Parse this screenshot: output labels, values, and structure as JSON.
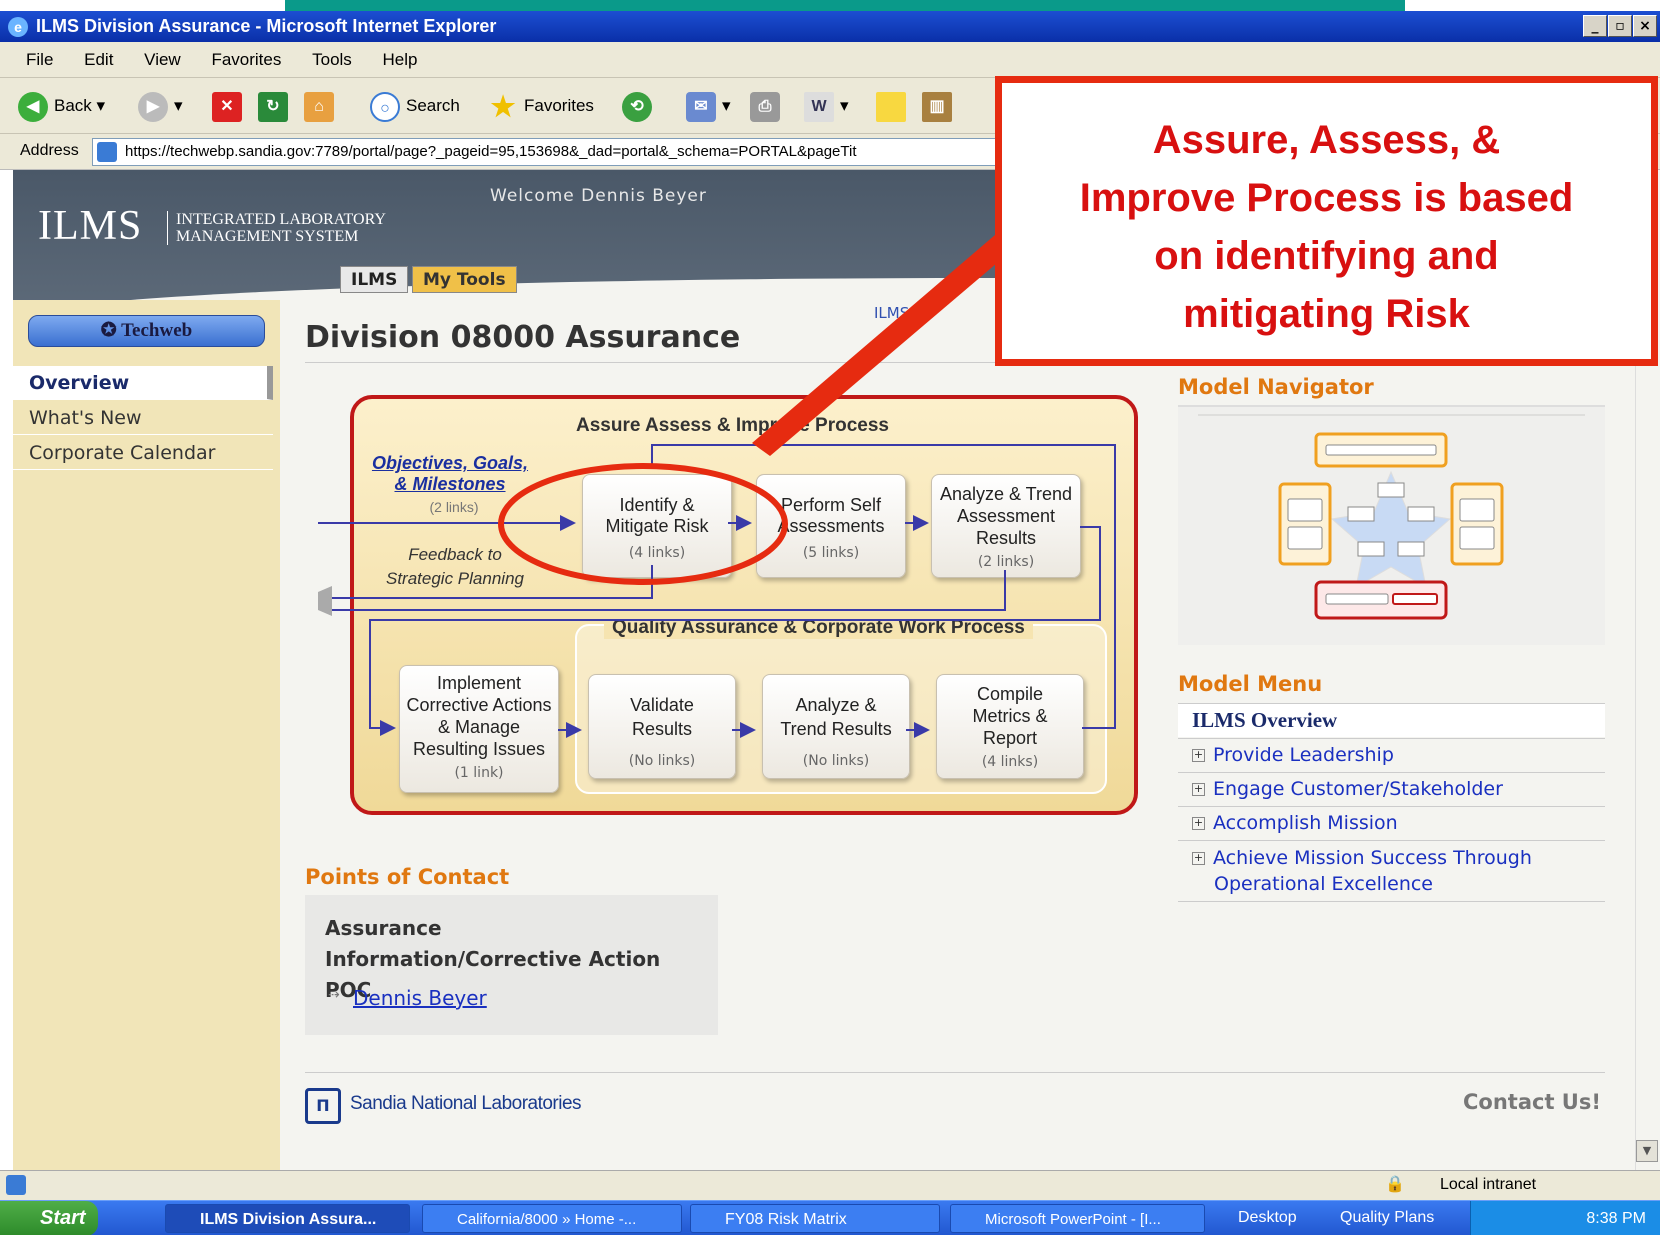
{
  "window": {
    "title": "ILMS Division Assurance - Microsoft Internet Explorer",
    "min": "_",
    "max": "ª",
    "close": "×"
  },
  "menu": [
    "File",
    "Edit",
    "View",
    "Favorites",
    "Tools",
    "Help"
  ],
  "toolbar": {
    "back": "Back",
    "search": "Search",
    "favorites": "Favorites"
  },
  "address": {
    "label": "Address",
    "url": "https://techwebp.sandia.gov:7789/portal/page?_pageid=95,153698&_dad=portal&_schema=PORTAL&pageTit"
  },
  "header": {
    "logo": "ILMS",
    "logo_sub_1": "INTEGRATED LABORATORY",
    "logo_sub_2": "MANAGEMENT SYSTEM",
    "welcome": "Welcome Dennis Beyer",
    "tab_ilms": "ILMS",
    "tab_mytools": "My Tools",
    "breadcrumb": "ILMS"
  },
  "sidebar": {
    "techweb": "Techweb",
    "items": [
      "Overview",
      "What's New",
      "Corporate Calendar"
    ]
  },
  "main": {
    "title": "Division 08000 Assurance"
  },
  "diagram": {
    "title_top": "Assure Assess & Improve Process",
    "title_bottom": "Quality Assurance & Corporate Work Process",
    "objectives_1": "Objectives, Goals,",
    "objectives_2": "& Milestones",
    "objectives_links": "(2 links)",
    "feedback_1": "Feedback to",
    "feedback_2": "Strategic Planning",
    "boxes": [
      {
        "l1": "Identify &",
        "l2": "Mitigate Risk",
        "l3": "",
        "links": "(4 links)"
      },
      {
        "l1": "Perform Self",
        "l2": "Assessments",
        "l3": "",
        "links": "(5 links)"
      },
      {
        "l1": "Analyze & Trend",
        "l2": "Assessment",
        "l3": "Results",
        "links": "(2 links)"
      },
      {
        "l1": "Implement",
        "l2": "Corrective Actions",
        "l3": "& Manage",
        "l4": "Resulting Issues",
        "links": "(1 link)"
      },
      {
        "l1": "Validate",
        "l2": "Results",
        "l3": "",
        "links": "(No links)"
      },
      {
        "l1": "Analyze &",
        "l2": "Trend Results",
        "l3": "",
        "links": "(No links)"
      },
      {
        "l1": "Compile",
        "l2": "Metrics &",
        "l3": "Report",
        "links": "(4 links)"
      }
    ]
  },
  "poc": {
    "title": "Points of Contact",
    "role": "Assurance Information/Corrective Action POC",
    "name": "Dennis Beyer"
  },
  "footer": {
    "sandia": "Sandia National Laboratories",
    "contact": "Contact Us!"
  },
  "right": {
    "navigator_title": "Model Navigator",
    "menu_title": "Model Menu",
    "menu_overview": "ILMS Overview",
    "menu_items": [
      "Provide Leadership",
      "Engage Customer/Stakeholder",
      "Accomplish Mission"
    ],
    "menu_item_4a": "Achieve Mission Success Through",
    "menu_item_4b": "Operational Excellence"
  },
  "status": {
    "zone": "Local intranet"
  },
  "taskbar": {
    "start": "Start",
    "tasks": [
      "ILMS Division Assura...",
      "California/8000 » Home -...",
      "FY08 Risk Matrix",
      "Microsoft PowerPoint - [I..."
    ],
    "desktop": "Desktop",
    "quality": "Quality Plans",
    "time": "8:38 PM"
  },
  "callout": {
    "line1": "Assure, Assess, &",
    "line2": "Improve Process is based",
    "line3": "on identifying and",
    "line4": "mitigating Risk"
  },
  "colors": {
    "accent": "#e07810",
    "callout": "#e62b10",
    "diagram_border": "#c01818"
  }
}
